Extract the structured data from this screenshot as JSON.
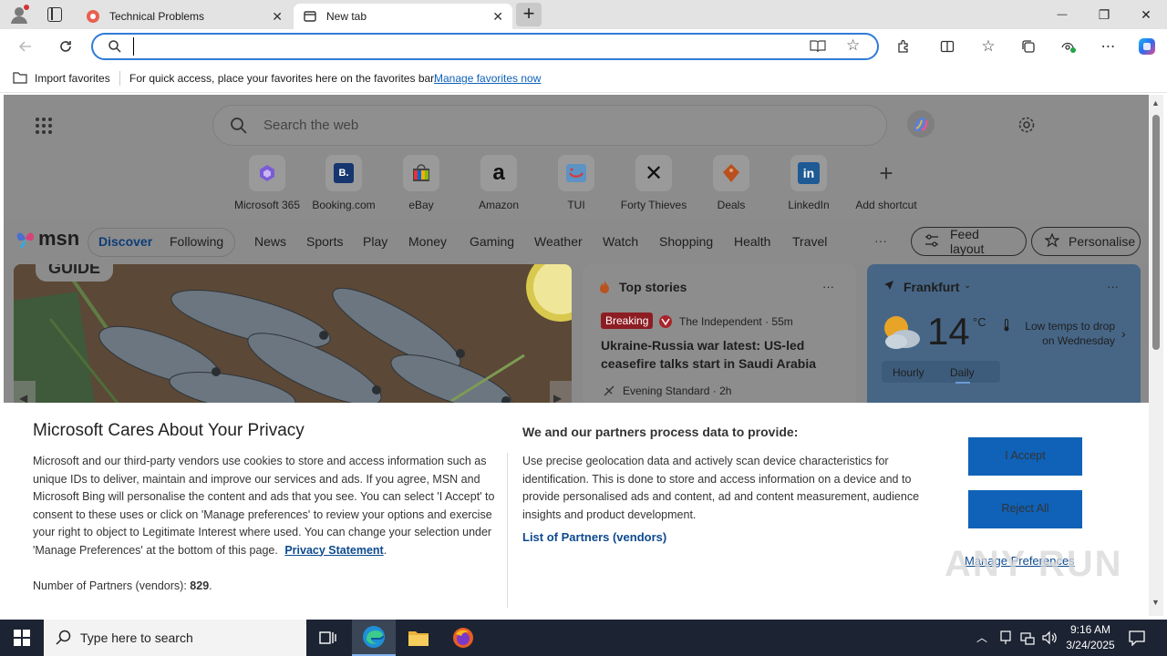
{
  "browser": {
    "tabs": [
      {
        "title": "Technical Problems",
        "close": "✕"
      },
      {
        "title": "New tab",
        "close": "✕"
      }
    ],
    "new_tab": "+",
    "window_controls": {
      "minimize": "—",
      "restore": "❐",
      "close": "✕"
    },
    "address": {
      "value": "",
      "placeholder": ""
    },
    "favorites_bar": {
      "import_label": "Import favorites",
      "message": "For quick access, place your favorites here on the favorites bar.",
      "manage_link": "Manage favorites now"
    }
  },
  "ntp": {
    "search_placeholder": "Search the web",
    "shortcuts": [
      {
        "label": "Microsoft 365"
      },
      {
        "label": "Booking.com",
        "glyph": "B."
      },
      {
        "label": "eBay"
      },
      {
        "label": "Amazon",
        "glyph": "a"
      },
      {
        "label": "TUI"
      },
      {
        "label": "Forty Thieves",
        "glyph": "✕"
      },
      {
        "label": "Deals"
      },
      {
        "label": "LinkedIn",
        "glyph": "in"
      },
      {
        "label": "Add shortcut",
        "glyph": "+"
      }
    ],
    "msn": {
      "logo": "msn",
      "tabs": [
        "Discover",
        "Following"
      ],
      "nav": [
        "News",
        "Sports",
        "Play",
        "Money",
        "Gaming",
        "Weather",
        "Watch",
        "Shopping",
        "Health",
        "Travel"
      ],
      "more": "···",
      "feed_layout": "Feed layout",
      "personalise": "Personalise"
    },
    "hero": {
      "badge": "GUIDE"
    },
    "top_stories": {
      "title": "Top stories",
      "more": "···",
      "breaking": "Breaking",
      "source1": "The Independent · 55m",
      "headline": "Ukraine-Russia war latest: US-led ceasefire talks start in Saudi Arabia afte...",
      "source2": "Evening Standard · 2h"
    },
    "weather": {
      "city": "Frankfurt",
      "more": "···",
      "temp": "14",
      "unit": "°C",
      "note": "Low temps to drop on Wednesday",
      "tabs": [
        "Hourly",
        "Daily"
      ]
    }
  },
  "privacy": {
    "title": "Microsoft Cares About Your Privacy",
    "body": "Microsoft and our third-party vendors use cookies to store and access information such as unique IDs to deliver, maintain and improve our services and ads. If you agree, MSN and Microsoft Bing will personalise the content and ads that you see. You can select 'I Accept' to consent to these uses or click on 'Manage preferences' to review your options and exercise your right to object to Legitimate Interest where used.  You can change your selection under 'Manage Preferences' at the bottom of this page.",
    "privacy_link": "Privacy Statement",
    "partners_label": "Number of Partners (vendors):",
    "partners_count": "829",
    "process_title": "We and our partners process data to provide:",
    "process_body": "Use precise geolocation data and actively scan device characteristics for identification. This is done to store and access information on a device and to provide personalised ads and content, ad and content measurement, audience insights and product development.",
    "partners_link": "List of Partners (vendors)",
    "accept": "I Accept",
    "reject": "Reject All",
    "manage": "Manage Preferences"
  },
  "watermark": "ANY RUN",
  "taskbar": {
    "search_placeholder": "Type here to search",
    "time": "9:16 AM",
    "date": "3/24/2025"
  },
  "colors": {
    "accent": "#0f62b8",
    "address_border": "#2f7bd6",
    "breaking": "#c4262e",
    "taskbar": "#1c2433"
  }
}
